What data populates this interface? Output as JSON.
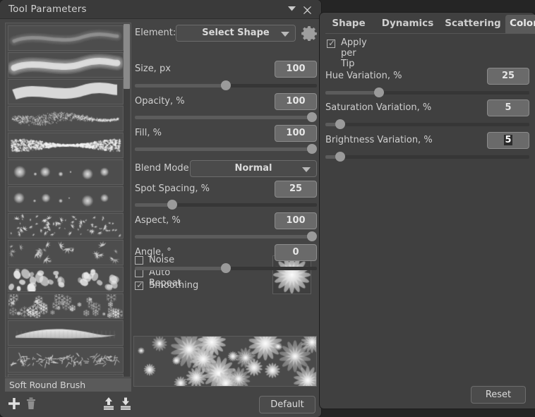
{
  "window": {
    "title": "Tool Parameters",
    "collapse_icon": "chevron-down-icon",
    "close_icon": "close-icon"
  },
  "brush_list": {
    "selected_name": "Soft Round Brush",
    "items": [
      {
        "name": "soft-round",
        "kind": "soft-stroke"
      },
      {
        "name": "airbrush-soft",
        "kind": "soft-stroke-thick"
      },
      {
        "name": "hard-round",
        "kind": "hard-stroke"
      },
      {
        "name": "bristle-rough",
        "kind": "noise-stroke"
      },
      {
        "name": "spatter",
        "kind": "spatter"
      },
      {
        "name": "soft-dots-large",
        "kind": "dots"
      },
      {
        "name": "soft-dots-small",
        "kind": "dots2"
      },
      {
        "name": "foliage-cluster",
        "kind": "clusters"
      },
      {
        "name": "maple-leaves",
        "kind": "leaves"
      },
      {
        "name": "petals",
        "kind": "petals"
      },
      {
        "name": "snowflakes",
        "kind": "snow"
      },
      {
        "name": "flat-blade",
        "kind": "blade"
      },
      {
        "name": "grass-tuft",
        "kind": "grass"
      },
      {
        "name": "bubbles",
        "kind": "bubbles"
      }
    ]
  },
  "bottom_bar": {
    "add_icon": "plus-icon",
    "delete_icon": "trash-icon",
    "import_icon": "import-up-icon",
    "export_icon": "export-down-icon",
    "default_label": "Default"
  },
  "parameters": {
    "element": {
      "label": "Element:",
      "value": "Select Shape",
      "settings_icon": "gear-icon"
    },
    "sliders": [
      {
        "label": "Size, px",
        "value": "100",
        "percent": 50
      },
      {
        "label": "Opacity, %",
        "value": "100",
        "percent": 100
      },
      {
        "label": "Fill, %",
        "value": "100",
        "percent": 100
      },
      {
        "label": "Spot Spacing, %",
        "value": "25",
        "percent": 19
      },
      {
        "label": "Aspect, %",
        "value": "100",
        "percent": 100
      },
      {
        "label": "Angle, °",
        "value": "0",
        "percent": 50
      }
    ],
    "blend_mode": {
      "label": "Blend Mode:",
      "value": "Normal"
    },
    "checkboxes": [
      {
        "label": "Noise",
        "checked": false
      },
      {
        "label": "Auto Repeat",
        "checked": false
      },
      {
        "label": "Smoothing",
        "checked": true
      }
    ],
    "tip_preview": "daisy-tip-preview",
    "stroke_preview": "daisy-stroke-preview"
  },
  "right_panel": {
    "tabs": [
      {
        "label": "Shape",
        "active": false
      },
      {
        "label": "Dynamics",
        "active": false
      },
      {
        "label": "Scattering",
        "active": false
      },
      {
        "label": "Color",
        "active": true
      }
    ],
    "apply_per_tip": {
      "label": "Apply per Tip",
      "checked": true
    },
    "sliders": [
      {
        "label": "Hue Variation, %",
        "value": "25",
        "percent": 25,
        "selected": false
      },
      {
        "label": "Saturation Variation, %",
        "value": "5",
        "percent": 5,
        "selected": false
      },
      {
        "label": "Brightness Variation, %",
        "value": "5",
        "percent": 5,
        "selected": true
      }
    ],
    "reset_label": "Reset"
  },
  "colors": {
    "window_bg": "#444444",
    "titlebar_bg": "#3a3a3a",
    "panel_bg": "#404040",
    "field_bg": "#6a6a6a",
    "text": "#cfcfcf",
    "accent_tab": "#5a5a5a",
    "knob": "#9a9a9a"
  }
}
